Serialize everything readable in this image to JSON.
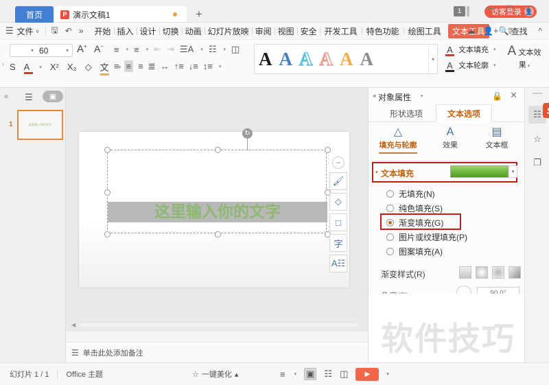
{
  "titlebar": {
    "home_tab": "首页",
    "doc_tab": {
      "icon_letter": "P",
      "title": "演示文稿1"
    },
    "new_tab": "+",
    "tab_count": "1",
    "login_label": "访客登录",
    "window": {
      "minimize": "—",
      "maximize": "▢",
      "close": "✕"
    }
  },
  "menubar": {
    "hamburger": "☰",
    "file": "文件",
    "caret": "∨",
    "quick_icons": [
      "save-icon",
      "undo-icon",
      "more-icon"
    ],
    "items": [
      "开始",
      "插入",
      "设计",
      "切换",
      "动画",
      "幻灯片放映",
      "审阅",
      "视图",
      "安全",
      "开发工具",
      "特色功能",
      "绘图工具"
    ],
    "active_item": "文本工具",
    "find_label": "查找",
    "right_icons": [
      "cloud-icon",
      "share-user-icon",
      "upload-icon",
      "more-vert-icon",
      "collapse-icon"
    ]
  },
  "ribbon": {
    "font_size": "60",
    "grow_font": "A",
    "shrink_font": "A",
    "format_icons_row2": [
      "strikethrough-icon",
      "font-color-icon",
      "superscript-icon",
      "subscript-icon",
      "clear-format-icon",
      "phonetic-icon"
    ],
    "paragraph_icons_row1": [
      "bullet-list-icon",
      "numbered-list-icon",
      "decrease-indent-icon",
      "increase-indent-icon",
      "text-direction-icon",
      "align-text-icon",
      "columns-icon"
    ],
    "paragraph_icons_row2": [
      "align-left-icon",
      "align-center-icon",
      "align-right-icon",
      "justify-icon",
      "distribute-icon",
      "line-spacing-icon",
      "space-before-icon",
      "space-after-icon"
    ],
    "wordart_gallery": {
      "letter": "A",
      "styles": [
        {
          "name": "wordart-black",
          "color": "#1a1a1a"
        },
        {
          "name": "wordart-blue",
          "color": "#4a7ebb"
        },
        {
          "name": "wordart-lightblue",
          "color": "#5bc0de"
        },
        {
          "name": "wordart-peach",
          "color": "#e8a190"
        },
        {
          "name": "wordart-orange",
          "color": "#f0ad4e"
        },
        {
          "name": "wordart-gray",
          "color": "#8c8c8c"
        }
      ]
    },
    "text_fill": {
      "label": "文本填充",
      "letter": "A",
      "underline_color": "#d23b2e"
    },
    "text_outline": {
      "label": "文本轮廓",
      "letter": "A",
      "underline_color": "#222222"
    },
    "text_effects": {
      "label": "文本效果",
      "letter": "A"
    }
  },
  "thumbnails": {
    "collapse": "«",
    "view_list_icon": "outline-view-icon",
    "view_slide_icon": "slide-view-icon",
    "slides": [
      {
        "number": "1",
        "text": "这里输入你的文字"
      }
    ]
  },
  "canvas": {
    "slide_text": "这里输入你的文字",
    "float_tools": [
      "minimize-icon",
      "brush-icon",
      "fill-bucket-icon",
      "shape-icon",
      "text-icon",
      "text-format-icon"
    ],
    "minus": "−"
  },
  "notes": {
    "icon": "notes-icon",
    "placeholder": "单击此处添加备注"
  },
  "properties_panel": {
    "title": "对象属性",
    "lock_icon": "lock-icon",
    "close_icon": "close-icon",
    "tabs": [
      {
        "label": "形状选项",
        "active": false
      },
      {
        "label": "文本选项",
        "active": true
      }
    ],
    "subtabs": [
      {
        "label": "填充与轮廓",
        "icon": "fill-outline-icon",
        "active": true
      },
      {
        "label": "效果",
        "icon": "effects-icon",
        "active": false
      },
      {
        "label": "文本框",
        "icon": "textbox-icon",
        "active": false
      }
    ],
    "text_fill": {
      "section_label": "文本填充",
      "swatch_color": "#6fb83e",
      "dropdown_caret": "▾"
    },
    "fill_options": [
      {
        "label": "无填充(N)",
        "selected": false
      },
      {
        "label": "纯色填充(S)",
        "selected": false
      },
      {
        "label": "渐变填充(G)",
        "selected": true
      },
      {
        "label": "图片或纹理填充(P)",
        "selected": false
      },
      {
        "label": "图案填充(A)",
        "selected": false
      }
    ],
    "gradient_style": {
      "label": "渐变样式(R)",
      "options": [
        "linear-gradient-swatch",
        "radial-light-swatch",
        "radial-dark-swatch",
        "diagonal-gradient-swatch"
      ]
    },
    "angle": {
      "label": "角度(E)",
      "value": "90.0°"
    },
    "highlight_color": "#c21b17"
  },
  "rail": {
    "buttons": [
      "properties-rail-icon",
      "favorites-rail-icon",
      "layers-rail-icon"
    ],
    "badge": "S"
  },
  "watermark": "软件技巧",
  "statusbar": {
    "slide_count": "幻灯片 1 / 1",
    "theme": "Office 主题",
    "beautify": "一键美化",
    "beautify_icon": "magic-icon",
    "beautify_caret": "▴",
    "view_icons": [
      "notes-view-icon",
      "normal-view-icon",
      "sorter-view-icon",
      "reading-view-icon"
    ],
    "play_icon": "▶",
    "play_caret": "▾"
  }
}
